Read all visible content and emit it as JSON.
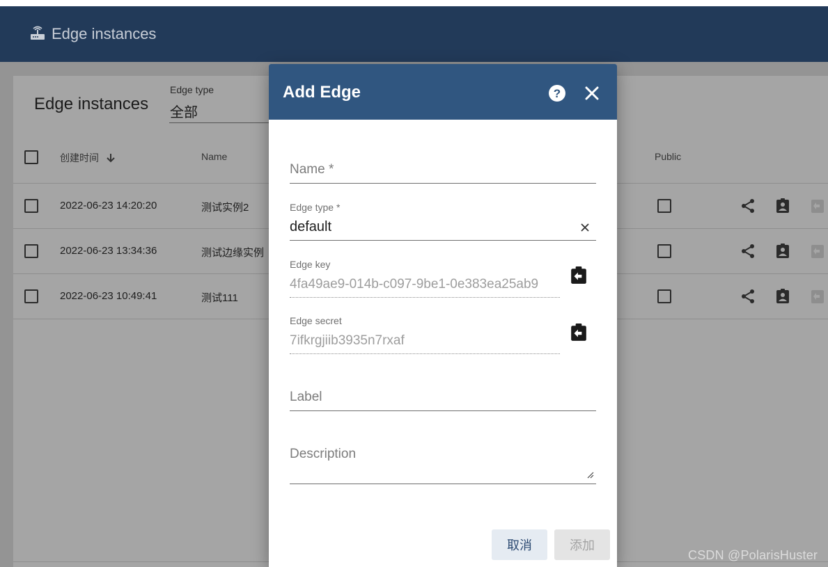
{
  "app": {
    "title": "Edge instances",
    "icon": "router-icon"
  },
  "card": {
    "title": "Edge instances",
    "filter": {
      "label": "Edge type",
      "value": "全部"
    }
  },
  "table": {
    "columns": {
      "created": "创建时间",
      "name": "Name",
      "public": "Public"
    },
    "rows": [
      {
        "created": "2022-06-23 14:20:20",
        "name": "测试实例2"
      },
      {
        "created": "2022-06-23 13:34:36",
        "name": "测试边缘实例"
      },
      {
        "created": "2022-06-23 10:49:41",
        "name": "测试111"
      }
    ]
  },
  "dialog": {
    "title": "Add Edge",
    "name_placeholder": "Name *",
    "edge_type": {
      "label": "Edge type *",
      "value": "default"
    },
    "edge_key": {
      "label": "Edge key",
      "value": "4fa49ae9-014b-c097-9be1-0e383ea25ab9"
    },
    "edge_secret": {
      "label": "Edge secret",
      "value": "7ifkrgjiib3935n7rxaf"
    },
    "label_placeholder": "Label",
    "description_placeholder": "Description",
    "cancel": "取消",
    "add": "添加"
  },
  "watermark": "CSDN @PolarisHuster",
  "colors": {
    "appbar": "#223a59",
    "dialog_header": "#305680",
    "overlay": "#9b9b9b",
    "cancel_bg": "#e5ebf2"
  }
}
